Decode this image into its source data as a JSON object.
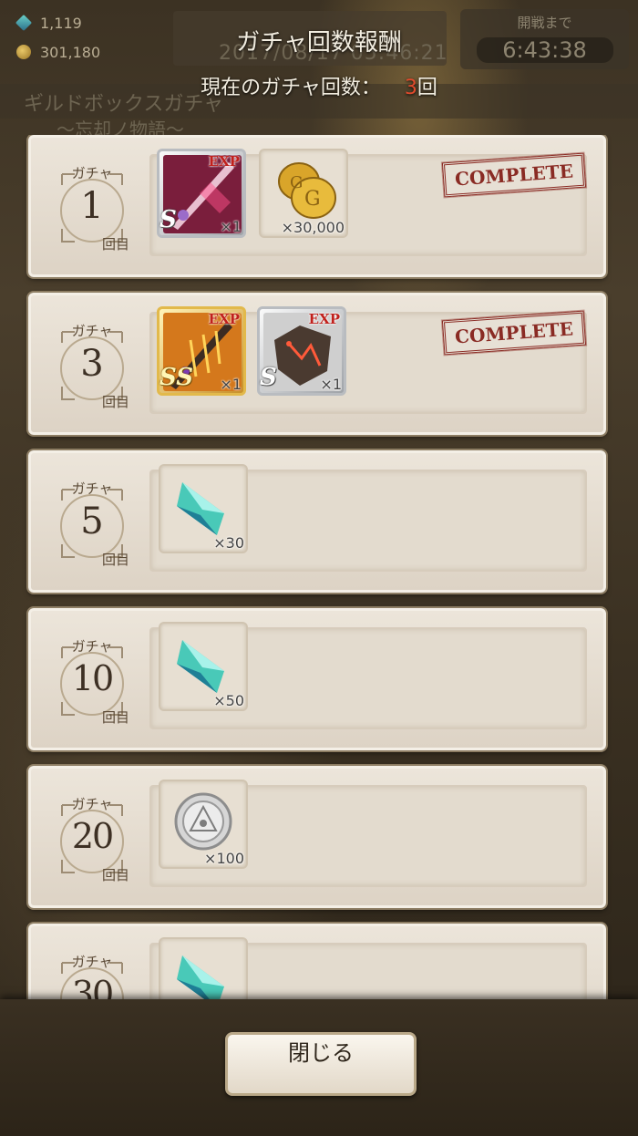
{
  "background": {
    "crystal_count": "1,119",
    "gold_count": "301,180",
    "datetime": "2017/08/17 05:46:21",
    "battle_label": "開戦まで",
    "battle_timer": "6:43:38",
    "gacha_title": "ギルドボックスガチャ",
    "gacha_subtitle": "〜忘却ノ物語〜"
  },
  "header": {
    "title": "ガチャ回数報酬",
    "count_label": "現在のガチャ回数：",
    "count_value": "3",
    "count_unit": "回"
  },
  "badge_label": "ガチャ",
  "badge_unit": "回目",
  "rewards": [
    {
      "count": "1",
      "complete": "COMPLETE",
      "items": [
        {
          "icon": "exp-weapon-pink-sword-icon",
          "rank": "S",
          "exp": "EXP",
          "qty": "×1"
        },
        {
          "icon": "gold-coins-icon",
          "qty": "×30,000"
        }
      ]
    },
    {
      "count": "3",
      "complete": "COMPLETE",
      "items": [
        {
          "icon": "exp-weapon-gold-blade-icon",
          "rank": "SS",
          "exp": "EXP",
          "qty": "×1"
        },
        {
          "icon": "exp-rune-stone-icon",
          "rank": "S",
          "exp": "EXP",
          "qty": "×1"
        }
      ]
    },
    {
      "count": "5",
      "items": [
        {
          "icon": "magic-crystal-icon",
          "qty": "×30"
        }
      ]
    },
    {
      "count": "10",
      "items": [
        {
          "icon": "magic-crystal-icon",
          "qty": "×50"
        }
      ]
    },
    {
      "count": "20",
      "items": [
        {
          "icon": "silver-medal-icon",
          "qty": "×100"
        }
      ]
    },
    {
      "count": "30",
      "items": [
        {
          "icon": "magic-crystal-icon",
          "qty": ""
        }
      ]
    }
  ],
  "footer": {
    "close_label": "閉じる"
  },
  "colors": {
    "count_highlight": "#e24a2c",
    "stamp": "#8a2b24",
    "panel": "#e3dbce"
  }
}
